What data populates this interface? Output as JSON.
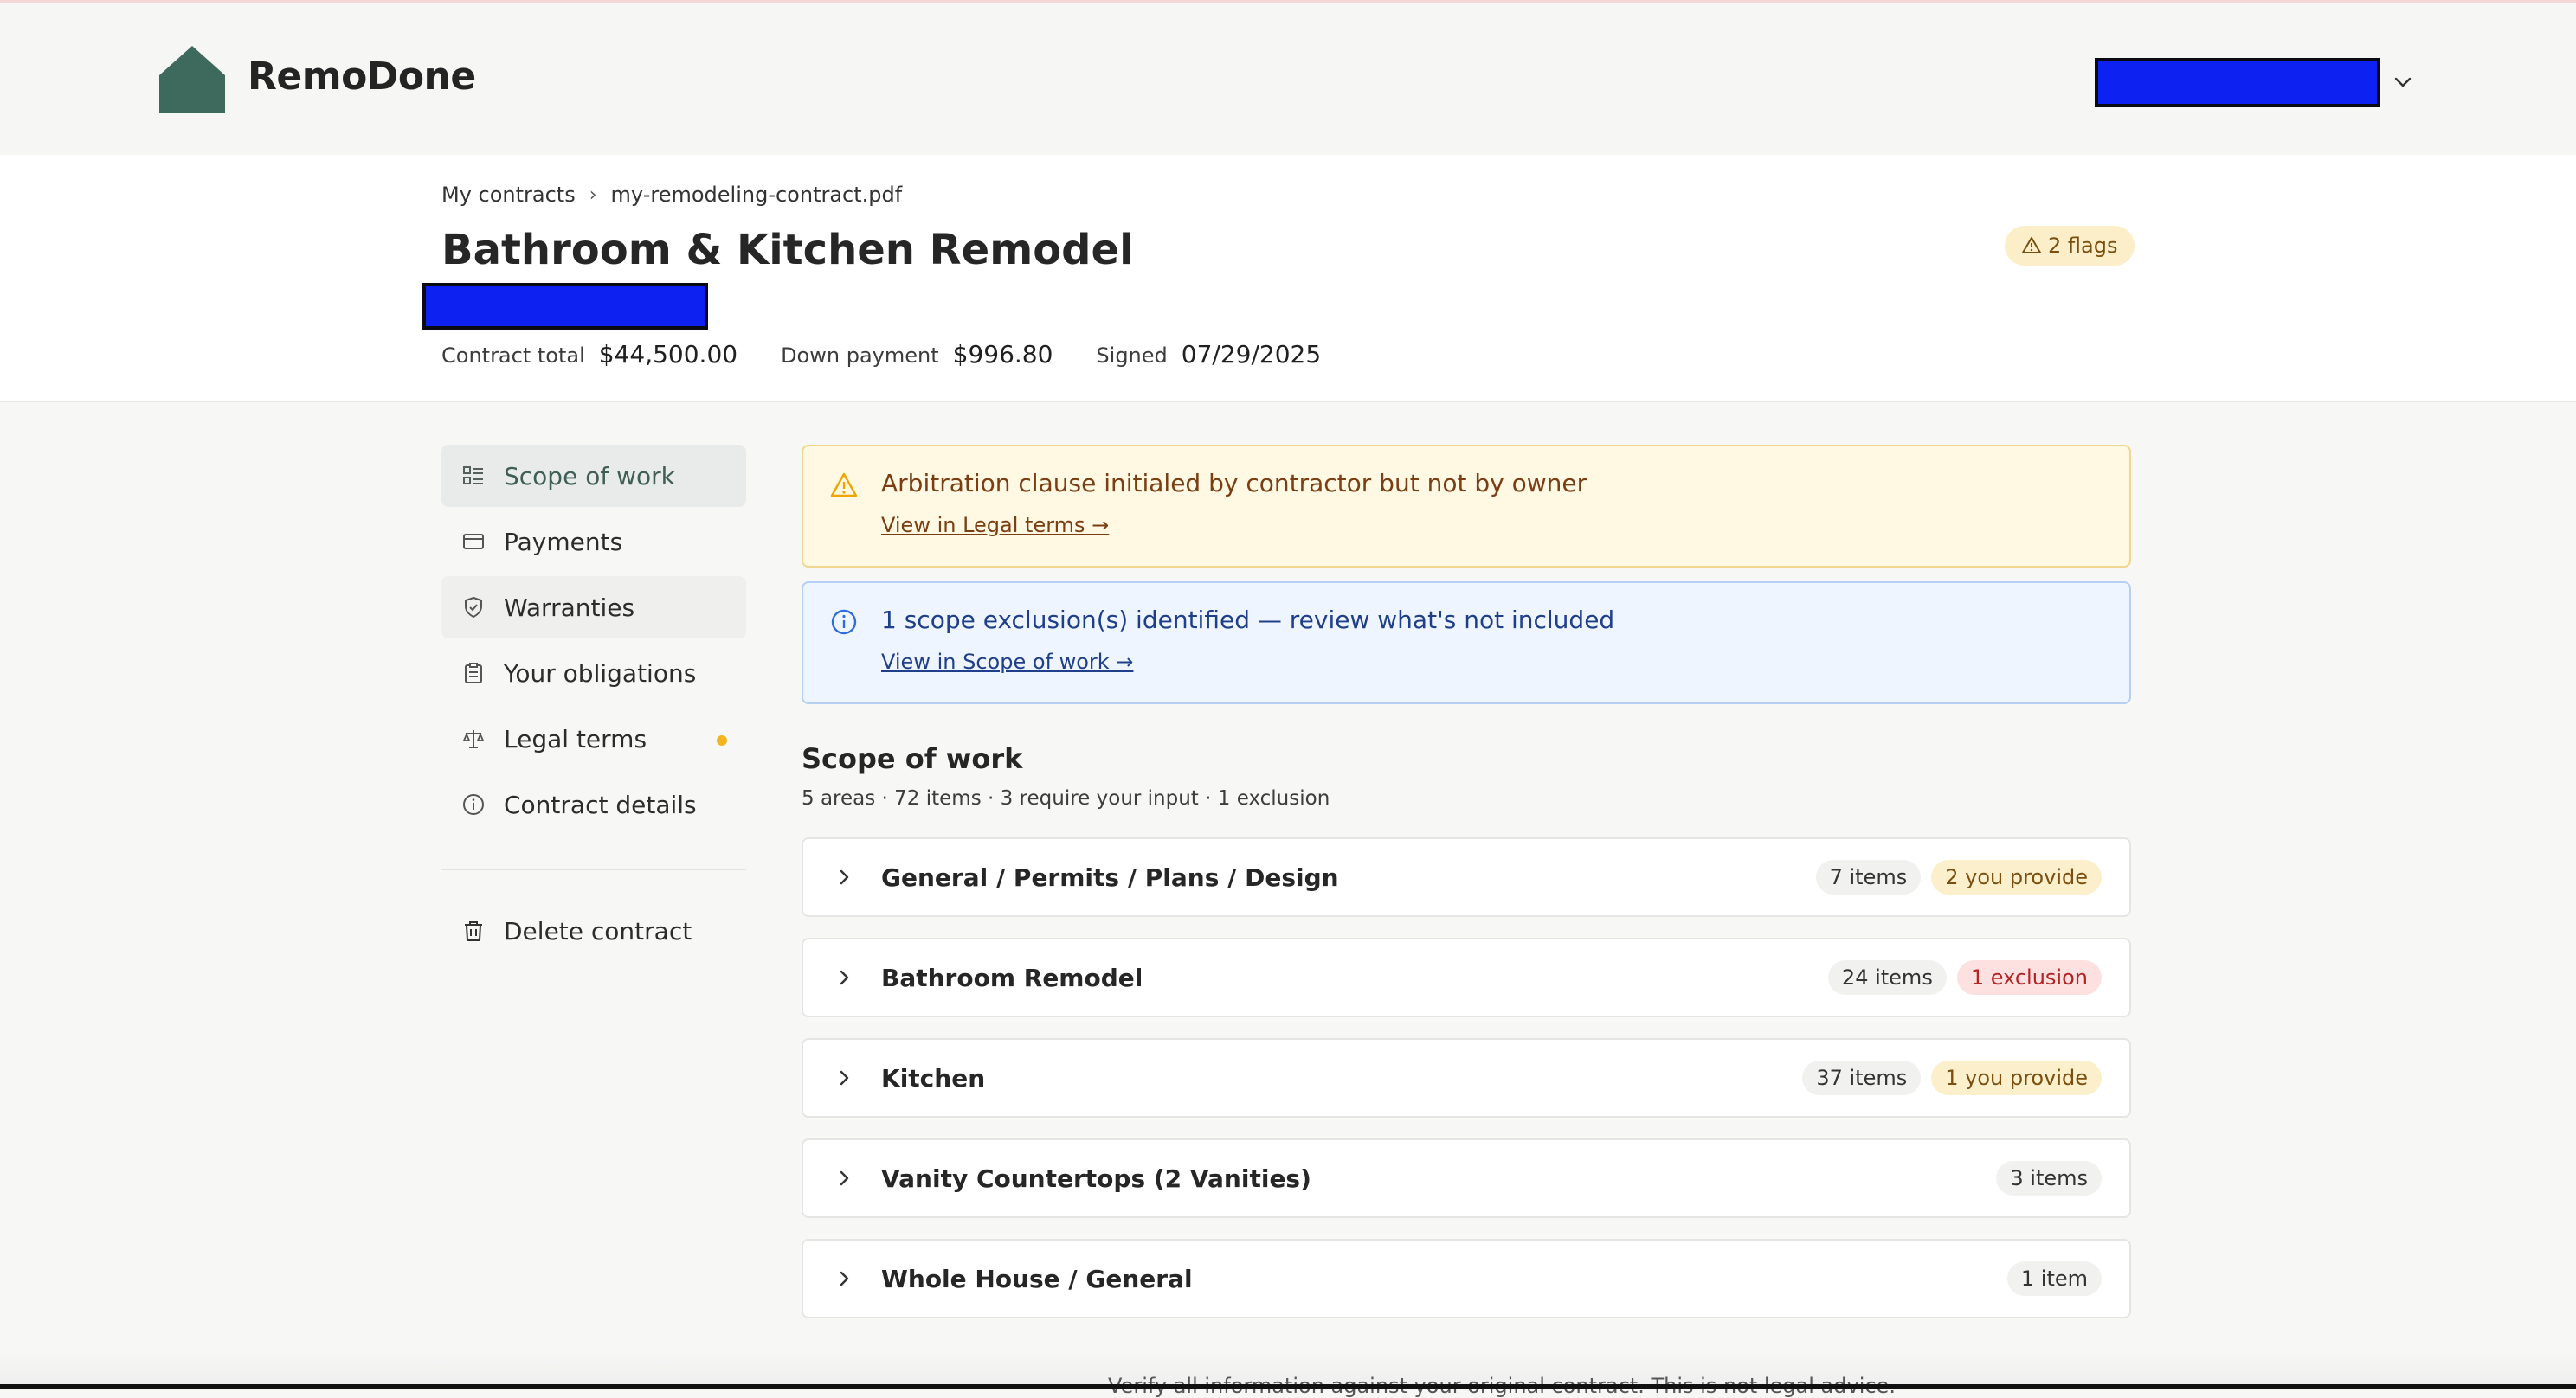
{
  "header": {
    "brand": "RemoDone",
    "brand_color": "#3d6a5d",
    "user_menu": {
      "redacted": true,
      "icon": "chevron-down-icon"
    }
  },
  "titlebar": {
    "breadcrumbs": [
      "My contracts",
      "my-remodeling-contract.pdf"
    ],
    "breadcrumb_separator": "›",
    "title": "Bathroom & Kitchen Remodel",
    "subtitle_redacted": true,
    "flags_badge": "2 flags",
    "stats": [
      {
        "label": "Contract total",
        "value": "$44,500.00"
      },
      {
        "label": "Down payment",
        "value": "$996.80"
      },
      {
        "label": "Signed",
        "value": "07/29/2025"
      }
    ]
  },
  "sidebar": {
    "items": [
      {
        "label": "Scope of work",
        "icon": "list-icon",
        "active": true
      },
      {
        "label": "Payments",
        "icon": "card-icon"
      },
      {
        "label": "Warranties",
        "icon": "shield-icon"
      },
      {
        "label": "Your obligations",
        "icon": "clipboard-icon"
      },
      {
        "label": "Legal terms",
        "icon": "scales-icon",
        "dot": true
      },
      {
        "label": "Contract details",
        "icon": "info-icon"
      }
    ],
    "delete": {
      "label": "Delete contract",
      "icon": "trash-icon"
    }
  },
  "alerts": [
    {
      "type": "warning",
      "text": "Arbitration clause initialed by contractor but not by owner",
      "link": "View in Legal terms →",
      "icon": "warning-icon",
      "color": "#f0a500"
    },
    {
      "type": "info",
      "text": "1 scope exclusion(s) identified — review what's not included",
      "link": "View in Scope of work →",
      "icon": "info-icon",
      "color": "#2f6ee0"
    }
  ],
  "scope": {
    "title": "Scope of work",
    "summary": "5 areas · 72 items · 3 require your input · 1 exclusion",
    "areas": [
      {
        "name": "General / Permits / Plans / Design",
        "count": "7 items",
        "flag": "2 you provide",
        "flag_type": "provide"
      },
      {
        "name": "Bathroom Remodel",
        "count": "24 items",
        "flag": "1 exclusion",
        "flag_type": "exclusion"
      },
      {
        "name": "Kitchen",
        "count": "37 items",
        "flag": "1 you provide",
        "flag_type": "provide"
      },
      {
        "name": "Vanity Countertops (2 Vanities)",
        "count": "3 items",
        "flag": "",
        "flag_type": ""
      },
      {
        "name": "Whole House / General",
        "count": "1 item",
        "flag": "",
        "flag_type": ""
      }
    ]
  },
  "footer": {
    "note": "Verify all information against your original contract. This is not legal advice."
  }
}
